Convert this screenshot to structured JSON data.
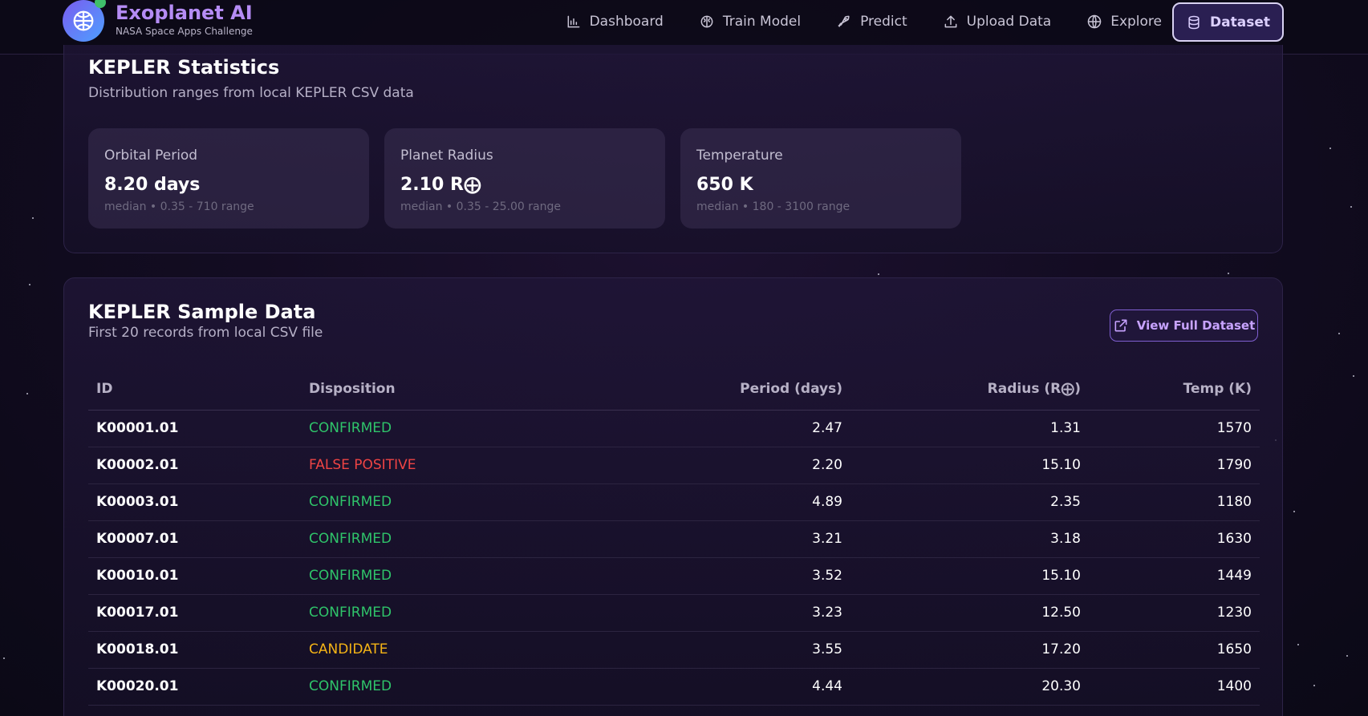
{
  "app": {
    "title": "Exoplanet AI",
    "subtitle": "NASA Space Apps Challenge",
    "accent": "#b58cf5"
  },
  "nav": {
    "items": [
      {
        "label": "Dashboard",
        "icon": "bar-chart-icon"
      },
      {
        "label": "Train Model",
        "icon": "brain-icon"
      },
      {
        "label": "Predict",
        "icon": "rocket-icon"
      },
      {
        "label": "Upload Data",
        "icon": "upload-icon"
      },
      {
        "label": "Explore",
        "icon": "globe-icon"
      }
    ],
    "active": {
      "label": "Dataset",
      "icon": "database-icon"
    }
  },
  "stats": {
    "title": "KEPLER Statistics",
    "subtitle": "Distribution ranges from local KEPLER CSV data",
    "cards": [
      {
        "label": "Orbital Period",
        "value": "8.20 days",
        "note": "median • 0.35 - 710 range"
      },
      {
        "label": "Planet Radius",
        "value": "2.10 R⨁",
        "note": "median • 0.35 - 25.00 range"
      },
      {
        "label": "Temperature",
        "value": "650 K",
        "note": "median • 180 - 3100 range"
      }
    ]
  },
  "sample": {
    "title": "KEPLER Sample Data",
    "subtitle": "First 20 records from local CSV file",
    "view_button": "View Full Dataset",
    "columns": [
      "ID",
      "Disposition",
      "Period (days)",
      "Radius (R⨁)",
      "Temp (K)"
    ],
    "status_colors": {
      "CONFIRMED": "#2fc46a",
      "FALSE POSITIVE": "#ef4444",
      "CANDIDATE": "#f5b416"
    },
    "rows": [
      {
        "id": "K00001.01",
        "disposition": "CONFIRMED",
        "period": "2.47",
        "radius": "1.31",
        "temp": "1570"
      },
      {
        "id": "K00002.01",
        "disposition": "FALSE POSITIVE",
        "period": "2.20",
        "radius": "15.10",
        "temp": "1790"
      },
      {
        "id": "K00003.01",
        "disposition": "CONFIRMED",
        "period": "4.89",
        "radius": "2.35",
        "temp": "1180"
      },
      {
        "id": "K00007.01",
        "disposition": "CONFIRMED",
        "period": "3.21",
        "radius": "3.18",
        "temp": "1630"
      },
      {
        "id": "K00010.01",
        "disposition": "CONFIRMED",
        "period": "3.52",
        "radius": "15.10",
        "temp": "1449"
      },
      {
        "id": "K00017.01",
        "disposition": "CONFIRMED",
        "period": "3.23",
        "radius": "12.50",
        "temp": "1230"
      },
      {
        "id": "K00018.01",
        "disposition": "CANDIDATE",
        "period": "3.55",
        "radius": "17.20",
        "temp": "1650"
      },
      {
        "id": "K00020.01",
        "disposition": "CONFIRMED",
        "period": "4.44",
        "radius": "20.30",
        "temp": "1400"
      }
    ]
  }
}
